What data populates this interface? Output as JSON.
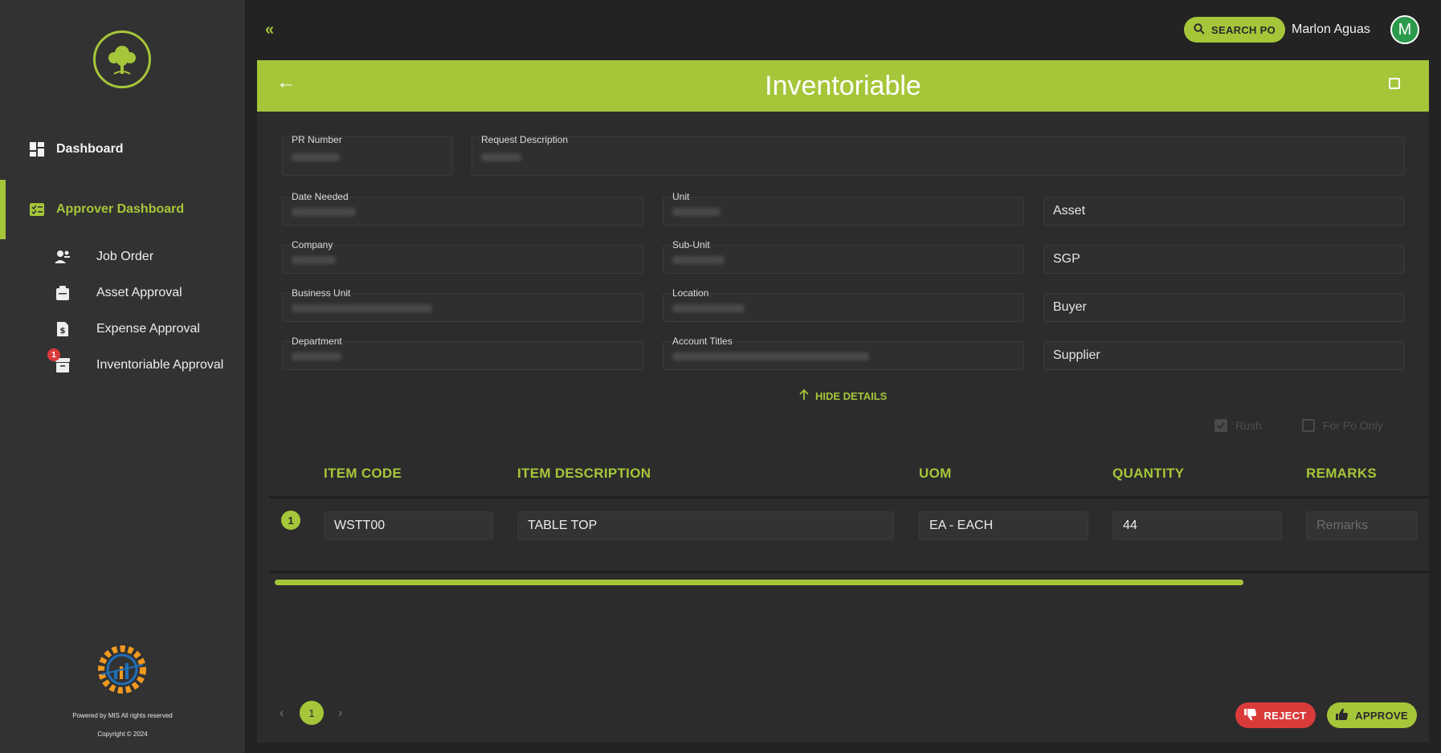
{
  "sidebar": {
    "nav": {
      "dashboard": "Dashboard",
      "approver_dashboard": "Approver Dashboard"
    },
    "sub_items": {
      "job_order": "Job Order",
      "asset_approval": "Asset Approval",
      "expense_approval": "Expense Approval",
      "inventoriable_approval": "Inventoriable Approval",
      "inventoriable_badge": "1"
    },
    "footer": {
      "powered": "Powered by MIS All rights reserved",
      "copyright": "Copyright © 2024"
    }
  },
  "topbar": {
    "search_label": "SEARCH PO",
    "user_name": "Marlon Aguas",
    "avatar_letter": "M"
  },
  "header": {
    "title": "Inventoriable"
  },
  "form": {
    "pr_number_label": "PR Number",
    "request_description_label": "Request Description",
    "date_needed_label": "Date Needed",
    "unit_label": "Unit",
    "company_label": "Company",
    "sub_unit_label": "Sub-Unit",
    "business_unit_label": "Business Unit",
    "location_label": "Location",
    "department_label": "Department",
    "account_titles_label": "Account Titles",
    "type_value": "Asset",
    "sgp_value": "SGP",
    "buyer_value": "Buyer",
    "supplier_value": "Supplier"
  },
  "details_toggle": "HIDE DETAILS",
  "checkboxes": {
    "rush": "Rush",
    "for_po_only": "For Po Only"
  },
  "table": {
    "headers": {
      "item_code": "ITEM CODE",
      "item_description": "ITEM DESCRIPTION",
      "uom": "UOM",
      "quantity": "QUANTITY",
      "remarks": "REMARKS"
    },
    "rows": [
      {
        "index": "1",
        "item_code": "WSTT00",
        "item_description": "TABLE TOP",
        "uom": "EA - EACH",
        "quantity": "44",
        "remarks_placeholder": "Remarks"
      }
    ]
  },
  "pagination": {
    "current_page": "1"
  },
  "actions": {
    "reject": "REJECT",
    "approve": "APPROVE"
  },
  "colors": {
    "accent": "#a6c63a",
    "reject": "#d93b3b",
    "avatar": "#2b9a4a"
  }
}
